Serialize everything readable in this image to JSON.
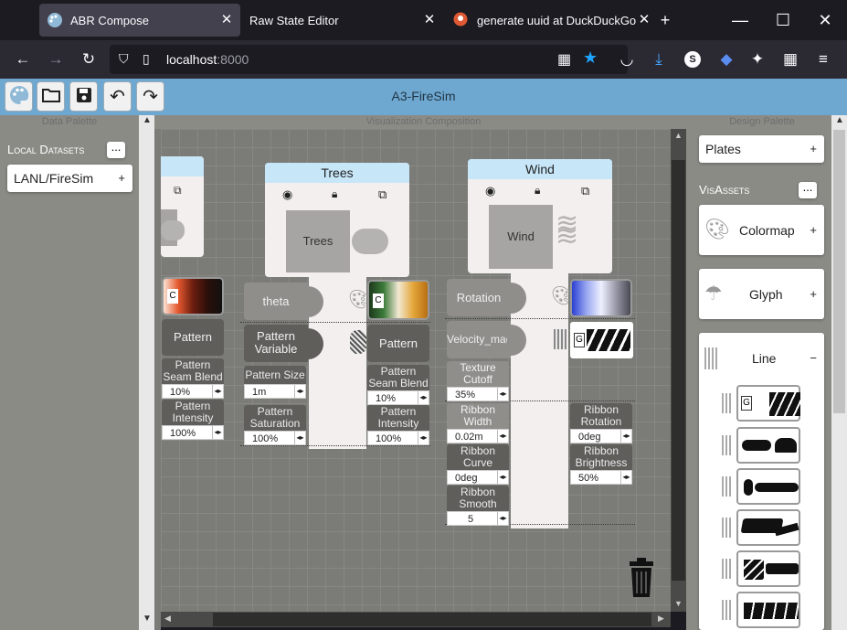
{
  "browser": {
    "tabs": [
      {
        "title": "ABR Compose",
        "active": true
      },
      {
        "title": "Raw State Editor",
        "active": false
      },
      {
        "title": "generate uuid at DuckDuckGo",
        "active": false
      }
    ],
    "url_host": "localhost",
    "url_port": ":8000"
  },
  "app": {
    "title": "A3-FireSim"
  },
  "panels": {
    "data": "Data Palette",
    "composition": "Visualization Composition",
    "design": "Design Palette"
  },
  "left": {
    "local_datasets": "Local Datasets",
    "more": "...",
    "dataset": "LANL/FireSim",
    "add": "+"
  },
  "right": {
    "plates": "Plates",
    "plates_add": "+",
    "visassets": "VisAssets",
    "more": "...",
    "colormap": "Colormap",
    "colormap_add": "+",
    "glyph": "Glyph",
    "glyph_add": "+",
    "line": "Line",
    "line_toggle": "−"
  },
  "plates": {
    "left": {
      "pattern": "Pattern",
      "seam_blend": "Pattern Seam Blend",
      "seam_blend_val": "10%",
      "intensity": "Pattern Intensity",
      "intensity_val": "100%",
      "cmap_label": "C"
    },
    "trees": {
      "title": "Trees",
      "thumb": "Trees",
      "var1": "theta",
      "var2": "Pattern Variable",
      "pattern": "Pattern",
      "pattern_size": "Pattern Size",
      "pattern_size_val": "1m",
      "pattern_saturation": "Pattern Saturation",
      "pattern_saturation_val": "100%",
      "seam_blend": "Pattern Seam Blend",
      "seam_blend_val": "10%",
      "intensity": "Pattern Intensity",
      "intensity_val": "100%",
      "cmap_label": "C"
    },
    "wind": {
      "title": "Wind",
      "thumb": "Wind",
      "var1": "Rotation",
      "var2": "Velocity_mag",
      "texture_cutoff": "Texture Cutoff",
      "texture_cutoff_val": "35%",
      "ribbon_width": "Ribbon Width",
      "ribbon_width_val": "0.02m",
      "ribbon_curve": "Ribbon Curve",
      "ribbon_curve_val": "0deg",
      "ribbon_smooth": "Ribbon Smooth",
      "ribbon_smooth_val": "5",
      "ribbon_rotation": "Ribbon Rotation",
      "ribbon_rotation_val": "0deg",
      "ribbon_brightness": "Ribbon Brightness",
      "ribbon_brightness_val": "50%",
      "glyph_label": "G"
    }
  },
  "line_glyph_label": "G",
  "colors": {
    "appbar": "#6ea8d0",
    "plate_header": "#c7e6f8",
    "accent_star": "#1ea5ff"
  }
}
